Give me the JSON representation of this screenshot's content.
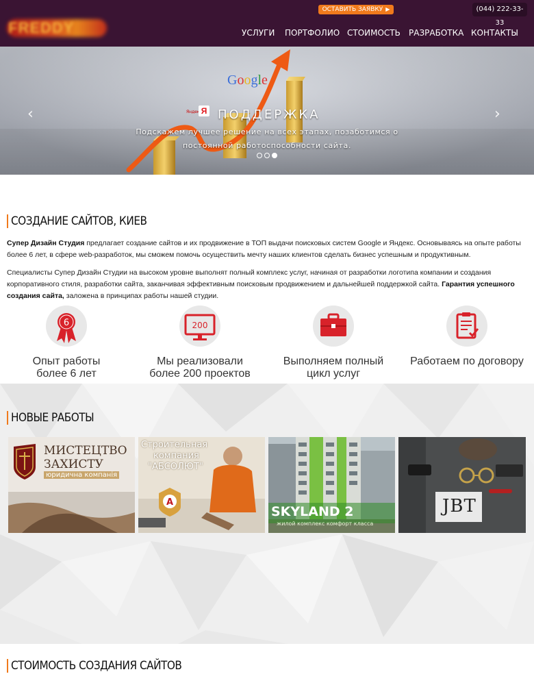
{
  "header": {
    "logo_text": "FREDDY",
    "cta_label": "ОСТАВИТЬ ЗАЯВКУ",
    "phone": "(044) 222-33-33",
    "nav": [
      "УСЛУГИ",
      "ПОРТФОЛИО",
      "СТОИМОСТЬ",
      "РАЗРАБОТКА",
      "КОНТАКТЫ"
    ]
  },
  "hero": {
    "google": "Google",
    "yandex_small": "Яндекс",
    "yandex_letter": "Я",
    "title": "ПОДДЕРЖКА",
    "caption": "Подскажем лучшее решение на всех этапах, позаботимся о постоянной работоспособности сайта.",
    "prev_arrow": "‹",
    "next_arrow": "›",
    "slide_count": 3,
    "active_slide": 3
  },
  "about": {
    "title": "СОЗДАНИЕ САЙТОВ, КИЕВ",
    "p1_bold": "Супер Дизайн Студия",
    "p1_rest": " предлагает создание сайтов  и их продвижение в ТОП выдачи поисковых систем Google и Яндекс. Основываясь на опыте работы более 6 лет, в сфере web-разработок, мы сможем помочь  осуществить мечту  наших клиентов сделать бизнес успешным и продуктивным.",
    "p2_start": "Специалисты Супер Дизайн Студии на высоком уровне выполнят полный комплекс услуг, начиная от разработки логотипа компании и создания корпоративного стиля, разработки сайта, заканчивая эффективным поисковым продвижением и дальнейшей поддержкой сайта. ",
    "p2_bold": "Гарантия успешного создания сайта,",
    "p2_end": " заложена в принципах работы нашей студии."
  },
  "features": [
    {
      "icon": "award-ribbon-icon",
      "badge": "6",
      "line1": "Опыт работы",
      "line2": "более 6 лет"
    },
    {
      "icon": "monitor-icon",
      "badge": "200",
      "line1": "Мы реализовали",
      "line2": "более 200 проектов"
    },
    {
      "icon": "briefcase-icon",
      "badge": "",
      "line1": "Выполняем полный",
      "line2": "цикл услуг"
    },
    {
      "icon": "contract-icon",
      "badge": "",
      "line1": "Работаем по договору",
      "line2": ""
    }
  ],
  "works": {
    "title": "НОВЫЕ РАБОТЫ",
    "items": [
      {
        "l1": "МИСТЕЦТВО",
        "l2": "ЗАХИСТУ",
        "l3": "юридична компанія"
      },
      {
        "l1": "Строительная",
        "l2": "компания",
        "l3": "\"АБСОЛЮТ\"",
        "emblem": "А"
      },
      {
        "l1": "SKYLAND 2",
        "l2": "жилой комплекс комфорт класса"
      },
      {
        "l1": "JBT"
      }
    ]
  },
  "pricing": {
    "title": "СТОИМОСТЬ СОЗДАНИЯ САЙТОВ"
  },
  "colors": {
    "header_bg": "#3a1433",
    "accent": "#f07a1c",
    "brand_red": "#d8222a"
  }
}
